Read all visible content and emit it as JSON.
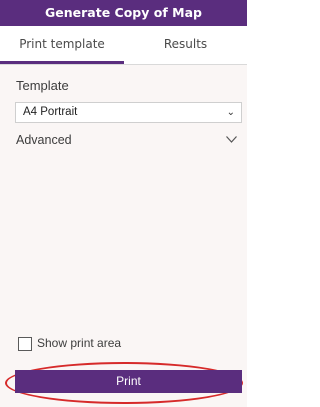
{
  "header": {
    "title": "Generate Copy of Map"
  },
  "tabs": [
    {
      "label": "Print template",
      "active": true
    },
    {
      "label": "Results",
      "active": false
    }
  ],
  "form": {
    "template_label": "Template",
    "template_value": "A4 Portrait",
    "advanced_label": "Advanced",
    "show_print_area_label": "Show print area",
    "show_print_area_checked": false
  },
  "actions": {
    "print_label": "Print"
  },
  "colors": {
    "accent": "#5a2d7e",
    "highlight_ring": "#d62a2a",
    "panel_bg": "#faf6f5"
  },
  "icons": {
    "select_chevron": "chevron-down-icon",
    "advanced_chevron": "chevron-down-icon"
  }
}
